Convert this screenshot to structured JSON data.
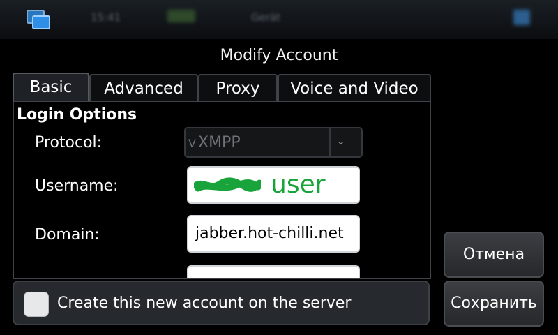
{
  "status_bar": {
    "time": "15:41",
    "profile": "Gerät"
  },
  "dialog": {
    "title": "Modify Account"
  },
  "tabs": [
    {
      "label": "Basic",
      "active": true
    },
    {
      "label": "Advanced",
      "active": false
    },
    {
      "label": "Proxy",
      "active": false
    },
    {
      "label": "Voice and Video",
      "active": false
    }
  ],
  "login_options": {
    "section_title": "Login Options",
    "protocol_label": "Protocol:",
    "protocol_value": "XMPP",
    "protocol_icon": "V",
    "username_label": "Username:",
    "username_value": "user",
    "domain_label": "Domain:",
    "domain_value": "jabber.hot-chilli.net"
  },
  "create_account": {
    "label": "Create this new account on the server",
    "checked": false
  },
  "buttons": {
    "cancel": "Отмена",
    "save": "Сохранить"
  },
  "colors": {
    "accent_blue": "#2f8fe6",
    "scribble_green": "#18a43a"
  }
}
